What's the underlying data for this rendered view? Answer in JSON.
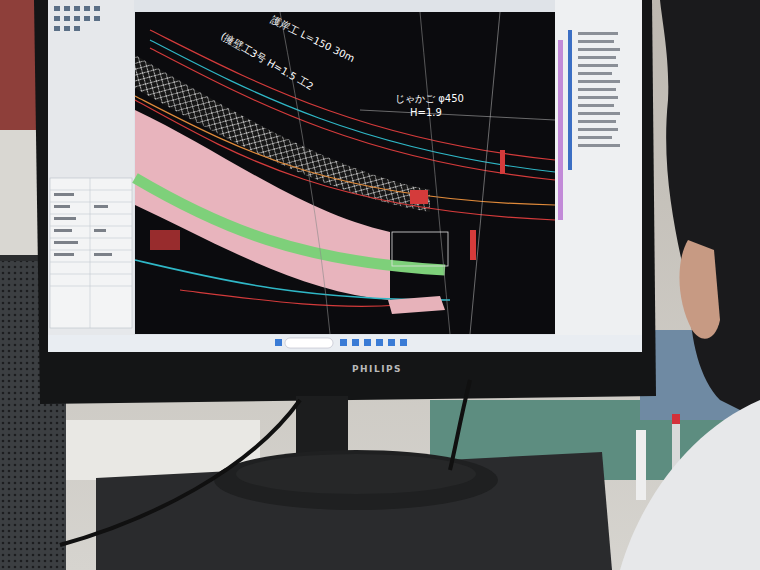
{
  "monitor": {
    "brand": "PHILIPS"
  },
  "cad": {
    "labels": [
      {
        "text": "護岸工 L=150 30m",
        "kind": "slanted"
      },
      {
        "text": "(擁壁工3号 H=1.5 工2",
        "kind": "slanted"
      },
      {
        "text": "じゃかご φ450",
        "kind": "flat"
      },
      {
        "text": "H=1.9",
        "kind": "flat"
      }
    ]
  }
}
